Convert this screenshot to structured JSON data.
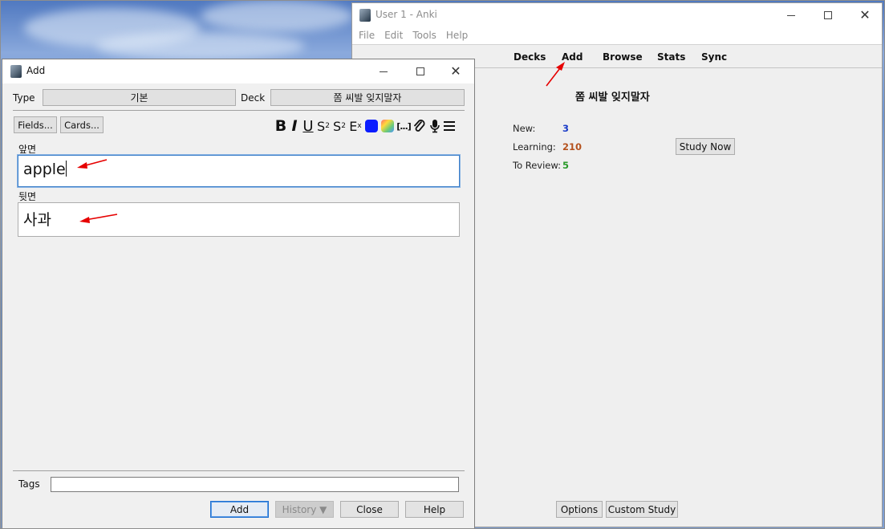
{
  "main_window": {
    "title": "User 1 - Anki",
    "menu": [
      "File",
      "Edit",
      "Tools",
      "Help"
    ],
    "nav": [
      "Decks",
      "Add",
      "Browse",
      "Stats",
      "Sync"
    ],
    "deck_title": "쫌 씨발 잊지말자",
    "stats": {
      "new_label": "New:",
      "new_value": "3",
      "learning_label": "Learning:",
      "learning_value": "210",
      "review_label": "To Review:",
      "review_value": "5"
    },
    "study_now": "Study Now",
    "options": "Options",
    "custom_study": "Custom Study",
    "colors": {
      "new": "#1a3cc8",
      "learning": "#b5521e",
      "review": "#2a9a2a"
    }
  },
  "add_dialog": {
    "title": "Add",
    "type_label": "Type",
    "type_value": "기본",
    "deck_label": "Deck",
    "deck_value": "쫌 씨발 잊지말자",
    "fields_button": "Fields...",
    "cards_button": "Cards...",
    "front_label": "앞면",
    "front_value": "apple",
    "back_label": "뒷면",
    "back_value": "사과",
    "tags_label": "Tags",
    "tags_value": "",
    "add_button": "Add",
    "history_button": "History ▼",
    "close_button": "Close",
    "help_button": "Help",
    "toolbar_icons": [
      "bold-icon",
      "italic-icon",
      "underline-icon",
      "superscript-icon",
      "subscript-icon",
      "clear-format-icon",
      "text-color-icon",
      "highlight-color-icon",
      "cloze-icon",
      "attach-icon",
      "record-audio-icon",
      "more-menu-icon"
    ],
    "swatch_colors": {
      "text": "#0a1cff",
      "highlight": "gradient"
    }
  }
}
